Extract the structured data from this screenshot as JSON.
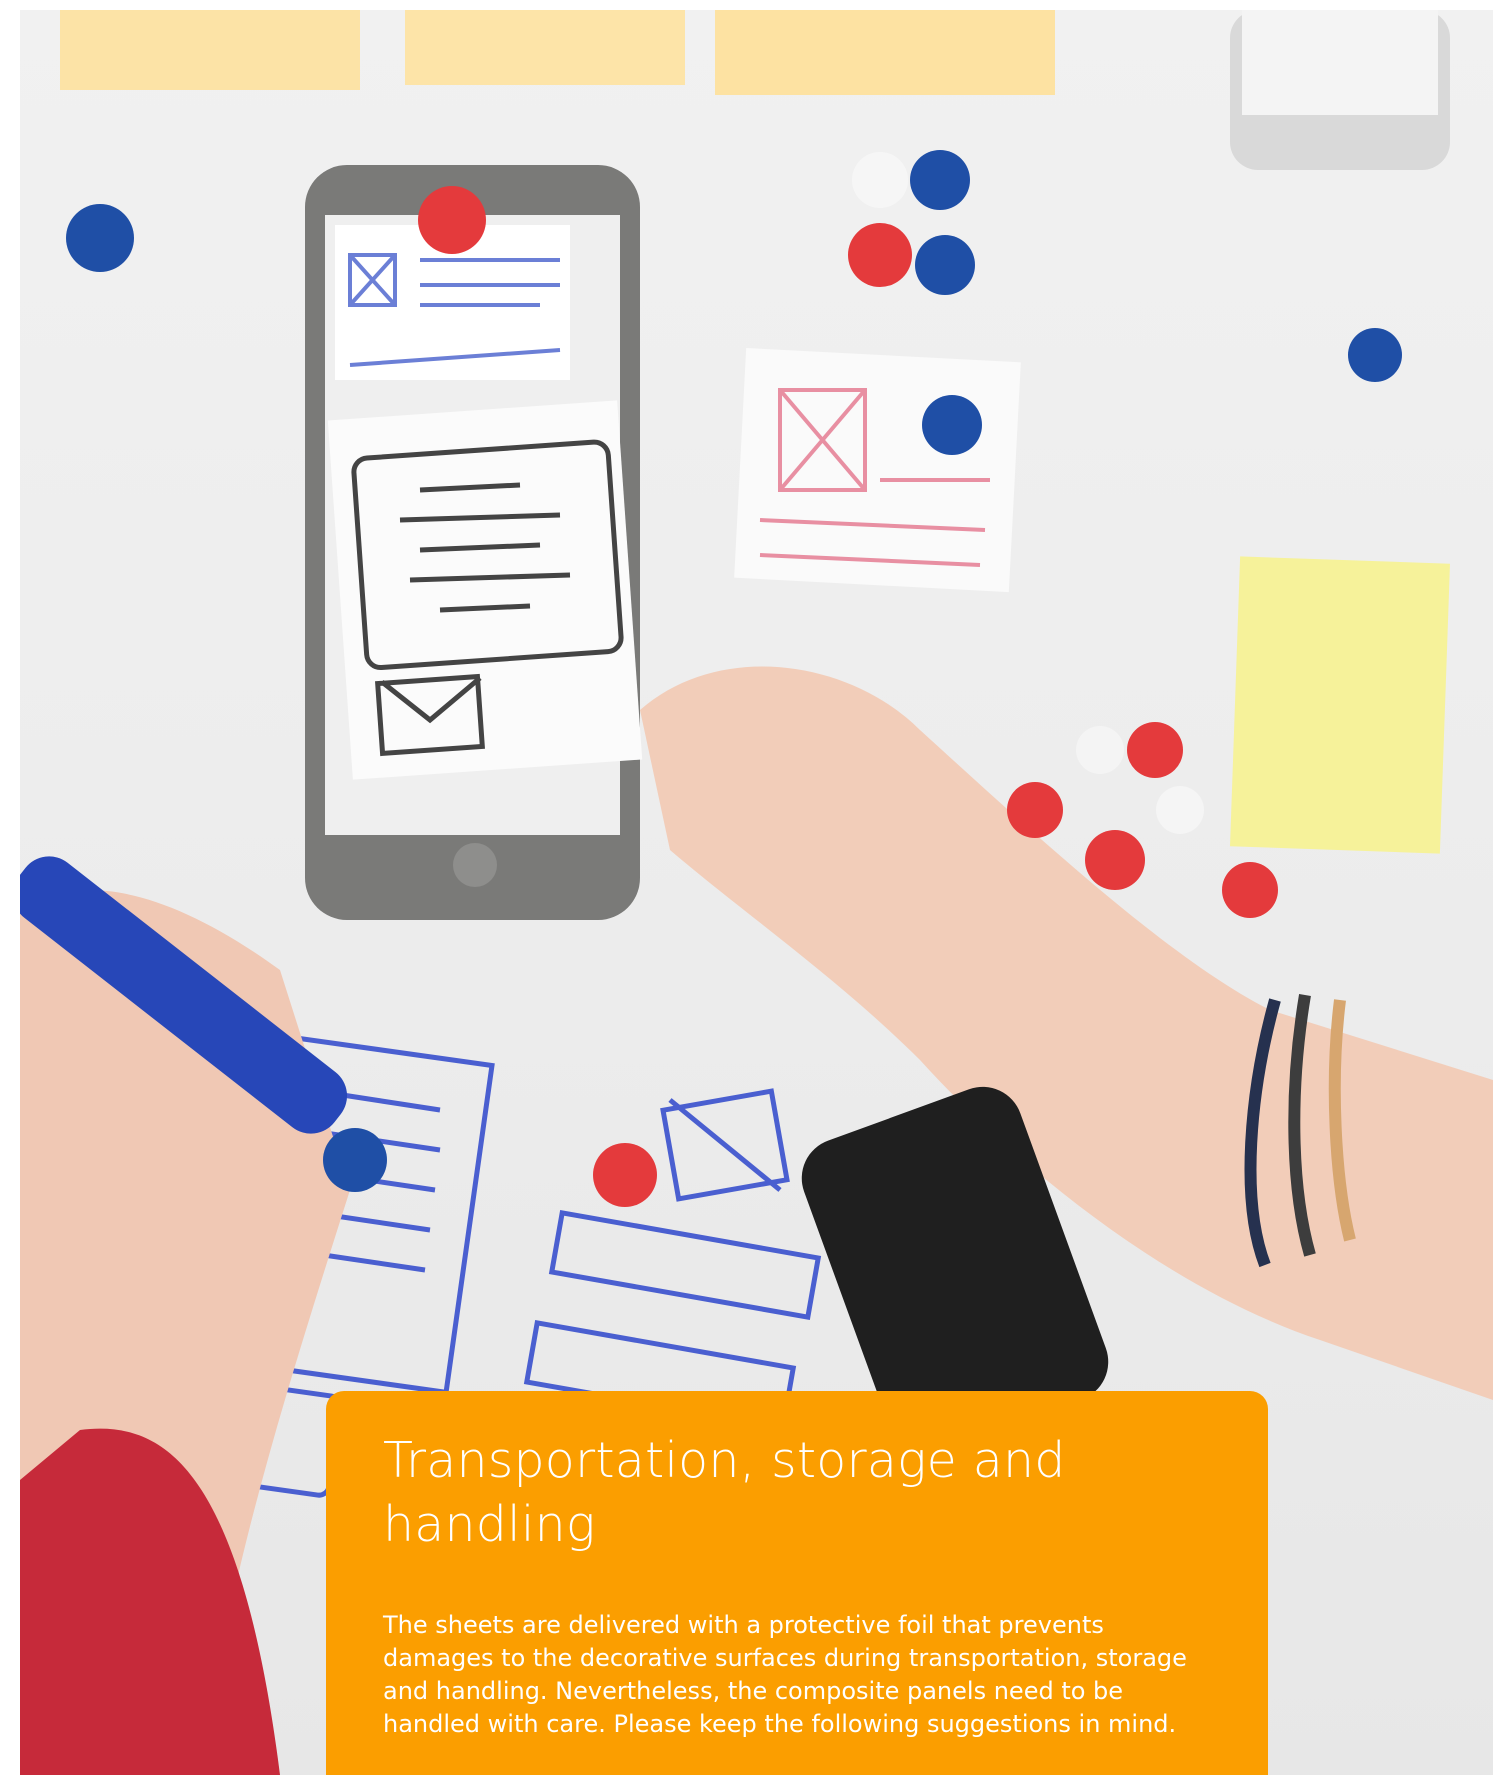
{
  "section": {
    "title": "Transportation, storage and handling",
    "body": "The sheets are delivered with a protective foil that prevents damages to the decorative surfaces during transportation, storage and handling. Nevertheless, the composite panels need to be handled with care. Please keep the following suggestions in mind."
  },
  "colors": {
    "accent": "#fb9e00",
    "text_on_accent": "#ffffff"
  }
}
